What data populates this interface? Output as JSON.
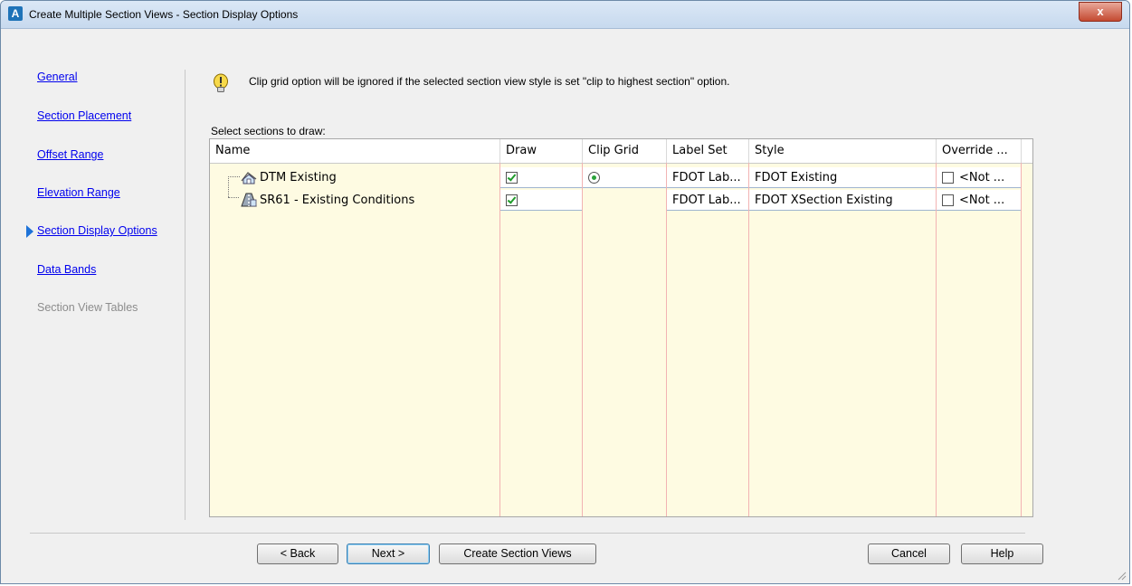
{
  "window": {
    "title": "Create Multiple Section Views - Section Display Options",
    "app_icon_letter": "A",
    "close_label": "x"
  },
  "nav": {
    "items": [
      {
        "label": "General",
        "active": false,
        "enabled": true
      },
      {
        "label": "Section Placement",
        "active": false,
        "enabled": true
      },
      {
        "label": "Offset Range",
        "active": false,
        "enabled": true
      },
      {
        "label": "Elevation Range",
        "active": false,
        "enabled": true
      },
      {
        "label": "Section Display Options",
        "active": true,
        "enabled": true
      },
      {
        "label": "Data Bands",
        "active": false,
        "enabled": true
      },
      {
        "label": "Section View Tables",
        "active": false,
        "enabled": false
      }
    ]
  },
  "hint": {
    "icon": "lightbulb-icon",
    "text": "Clip grid option will be ignored if the selected section view style is set \"clip to highest section\" option."
  },
  "grid": {
    "caption": "Select sections to draw:",
    "columns": [
      "Name",
      "Draw",
      "Clip Grid",
      "Label Set",
      "Style",
      "Override ..."
    ],
    "rows": [
      {
        "name": "DTM Existing",
        "icon": "surface-section-icon",
        "draw": true,
        "clip_grid": true,
        "label_set": "FDOT Lab...",
        "style": "FDOT Existing",
        "override": false,
        "override_text": "<Not ..."
      },
      {
        "name": "SR61 - Existing Conditions",
        "icon": "corridor-section-icon",
        "draw": true,
        "clip_grid": false,
        "label_set": "FDOT Lab...",
        "style": "FDOT XSection Existing",
        "override": false,
        "override_text": "<Not ..."
      }
    ]
  },
  "buttons": {
    "back": "< Back",
    "next": "Next >",
    "create": "Create Section Views",
    "cancel": "Cancel",
    "help": "Help"
  }
}
